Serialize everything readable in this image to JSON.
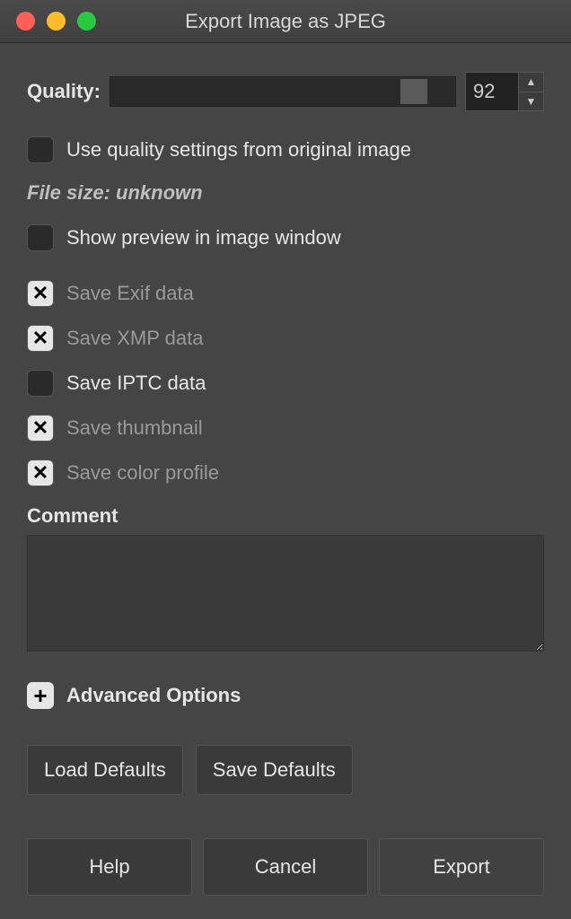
{
  "title": "Export Image as JPEG",
  "quality": {
    "label": "Quality:",
    "value": "92",
    "slider_pct": 92
  },
  "options": {
    "use_original_quality": {
      "label": "Use quality settings from original image",
      "checked": false
    },
    "filesize_text": "File size: unknown",
    "show_preview": {
      "label": "Show preview in image window",
      "checked": false
    },
    "save_exif": {
      "label": "Save Exif data",
      "checked": true
    },
    "save_xmp": {
      "label": "Save XMP data",
      "checked": true
    },
    "save_iptc": {
      "label": "Save IPTC data",
      "checked": false
    },
    "save_thumb": {
      "label": "Save thumbnail",
      "checked": true
    },
    "save_color": {
      "label": "Save color profile",
      "checked": true
    }
  },
  "comment": {
    "label": "Comment",
    "value": ""
  },
  "advanced_label": "Advanced Options",
  "buttons": {
    "load_defaults": "Load Defaults",
    "save_defaults": "Save Defaults",
    "help": "Help",
    "cancel": "Cancel",
    "export": "Export"
  }
}
